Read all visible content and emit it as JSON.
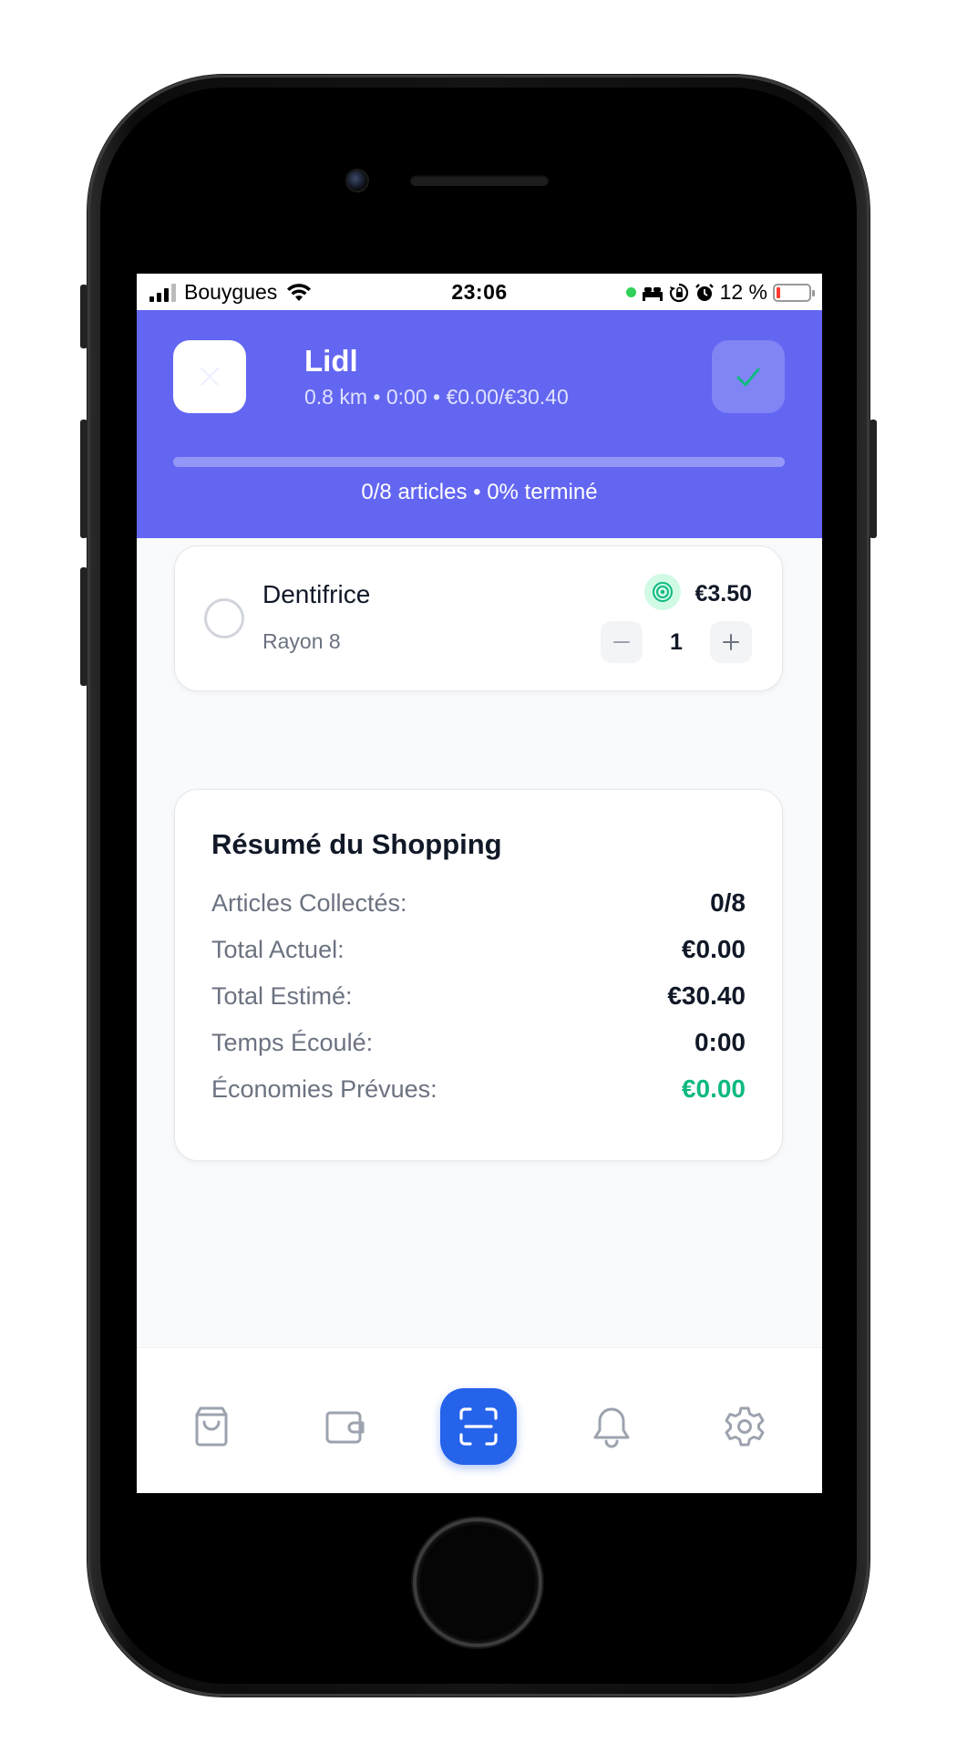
{
  "status_bar": {
    "carrier": "Bouygues",
    "time": "23:06",
    "battery": "12 %",
    "battery_level": 0.12
  },
  "header": {
    "store_name": "Lidl",
    "subtitle": "0.8 km • 0:00 • €0.00/€30.40",
    "progress_text": "0/8 articles • 0% terminé",
    "progress_fraction": 0,
    "colors": {
      "background": "#6366f1",
      "confirm_check": "#10b981"
    }
  },
  "items": [
    {
      "name": "Dentifrice",
      "aisle": "Rayon 8",
      "price": "€3.50",
      "quantity": "1",
      "checked": false,
      "badge_icon": "target-icon"
    }
  ],
  "summary": {
    "title": "Résumé du Shopping",
    "rows": [
      {
        "label": "Articles Collectés:",
        "value": "0/8"
      },
      {
        "label": "Total Actuel:",
        "value": "€0.00"
      },
      {
        "label": "Total Estimé:",
        "value": "€30.40"
      },
      {
        "label": "Temps Écoulé:",
        "value": "0:00"
      },
      {
        "label": "Économies Prévues:",
        "value": "€0.00",
        "color": "#10b981"
      }
    ]
  },
  "bottom_nav": {
    "items": [
      {
        "icon": "shopping-bag-icon",
        "active": false
      },
      {
        "icon": "wallet-icon",
        "active": false
      },
      {
        "icon": "scan-icon",
        "active": true,
        "color": "#2563eb"
      },
      {
        "icon": "bell-icon",
        "active": false
      },
      {
        "icon": "settings-icon",
        "active": false
      }
    ]
  }
}
